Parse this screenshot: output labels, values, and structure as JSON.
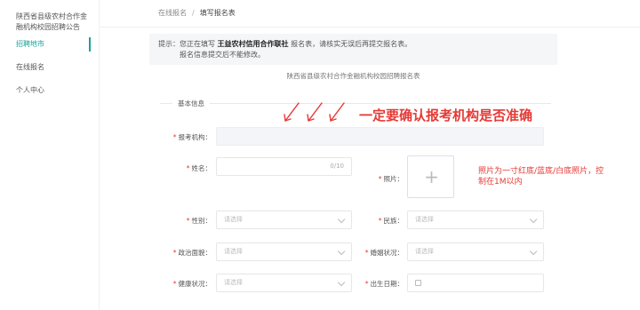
{
  "sidebar": {
    "title": "陕西省县级农村合作金融机构校园招聘公告",
    "items": [
      {
        "label": "招聘地市",
        "active": true
      },
      {
        "label": "在线报名",
        "active": false
      },
      {
        "label": "个人中心",
        "active": false
      }
    ]
  },
  "breadcrumb": {
    "items": [
      "在线报名",
      "填写报名表"
    ],
    "separator": "/"
  },
  "notice": {
    "prefix": "提示：",
    "text_before": "您正在填写",
    "institution": "王益农村信用合作联社",
    "text_after": "报名表，请核实无误后再提交报名表。",
    "line2": "报名信息提交后不能修改。"
  },
  "form_title": "陕西省县级农村合作金融机构校园招聘报名表",
  "section_label": "基本信息",
  "annotation": {
    "text": "一定要确认报考机构是否准确",
    "photo_note": "照片为一寸红底/蓝底/白底照片，控制在1M以内"
  },
  "fields": {
    "institution": {
      "label": "报考机构：",
      "value": ""
    },
    "name": {
      "label": "姓名：",
      "value": "",
      "count": "0/10"
    },
    "photo": {
      "label": "照片："
    },
    "gender": {
      "label": "性别：",
      "placeholder": "请选择"
    },
    "ethnicity": {
      "label": "民族：",
      "placeholder": "请选择"
    },
    "political": {
      "label": "政治面貌：",
      "placeholder": "请选择"
    },
    "marital": {
      "label": "婚姻状况：",
      "placeholder": "请选择"
    },
    "health": {
      "label": "健康状况：",
      "placeholder": "请选择"
    },
    "birthdate": {
      "label": "出生日期：",
      "placeholder": ""
    }
  },
  "colors": {
    "accent": "#1aa39a",
    "annotation": "#e53935",
    "required": "#e53935"
  }
}
